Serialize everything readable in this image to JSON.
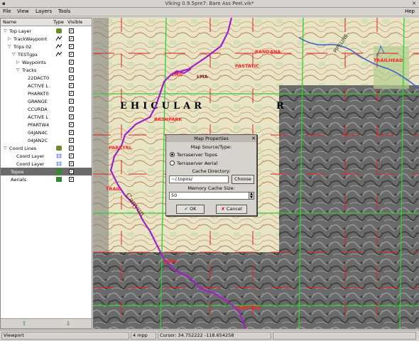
{
  "window": {
    "title": "Viking 0.9.5pre7: Bare Ass Peel.vik*",
    "close_glyph": "✕",
    "help_label": "Hep"
  },
  "menu": {
    "items": [
      "File",
      "View",
      "Layers",
      "Tools"
    ]
  },
  "layers_panel": {
    "headers": {
      "name": "Name",
      "type": "Type",
      "visible": "Visible"
    },
    "rows": [
      {
        "label": "Top Layer",
        "exp": "▽",
        "type": "aggregate-icon",
        "checked": true
      },
      {
        "label": "TrackWaypoint",
        "exp": "▷",
        "type": "trw-icon",
        "checked": true
      },
      {
        "label": "Trips 02",
        "exp": "▽",
        "type": "trw-icon",
        "checked": true
      },
      {
        "label": "TESTgps",
        "exp": "▽",
        "type": "trw-icon",
        "checked": true
      },
      {
        "label": "Waypoints",
        "exp": "▷",
        "type": "",
        "checked": true
      },
      {
        "label": "Tracks",
        "exp": "▽",
        "type": "",
        "checked": true
      },
      {
        "label": "22DACT0",
        "exp": "",
        "type": "",
        "checked": true
      },
      {
        "label": "ACTIVE L",
        "exp": "",
        "type": "",
        "checked": true
      },
      {
        "label": "PHARKT0",
        "exp": "",
        "type": "",
        "checked": true
      },
      {
        "label": "GRANGE",
        "exp": "",
        "type": "",
        "checked": true
      },
      {
        "label": "CCURDA",
        "exp": "",
        "type": "",
        "checked": true
      },
      {
        "label": "ACTIVE L",
        "exp": "",
        "type": "",
        "checked": true
      },
      {
        "label": "PFARTW4",
        "exp": "",
        "type": "",
        "checked": true
      },
      {
        "label": "04JAN4C",
        "exp": "",
        "type": "",
        "checked": true
      },
      {
        "label": "04JAN2C",
        "exp": "",
        "type": "",
        "checked": true
      },
      {
        "label": "Coord Lines",
        "exp": "▽",
        "type": "aggregate-icon",
        "checked": true
      },
      {
        "label": "Coord Layer",
        "exp": "",
        "type": "coord-icon",
        "checked": true
      },
      {
        "label": "Coord Layer",
        "exp": "",
        "type": "coord-icon",
        "checked": true
      },
      {
        "label": "Topos",
        "exp": "",
        "type": "map-icon",
        "checked": true,
        "selected": true
      },
      {
        "label": "Aerials",
        "exp": "",
        "type": "map-icon",
        "checked": true
      }
    ],
    "bottom": {
      "up_glyph": "⇧",
      "down_glyph": "⇩"
    }
  },
  "map": {
    "topo_labels": {
      "vehicular": "EHICULAR",
      "vehicular2": "R",
      "pipeline": "PIPELINE",
      "canyon": "Canyon"
    },
    "waypoints": [
      "1MG",
      "LMA",
      "PARKTRL",
      "BASHPARK",
      "PASTATIC",
      "BANDANA",
      "TRAIL",
      "TRAILHEAD",
      "MARTINA",
      "1993"
    ]
  },
  "dialog": {
    "title": "Map Properties",
    "close_glyph": "✕",
    "source_label": "Map Source/Type:",
    "options": [
      {
        "label": "Terraserver Topos",
        "selected": true
      },
      {
        "label": "Terraserver Aerial",
        "selected": false
      }
    ],
    "cache_label": "Cache Directory:",
    "cache_value": "~/.topos/",
    "choose_label": "Choose",
    "memory_label": "Memory Cache Size:",
    "memory_value": "50",
    "ok_label": "OK",
    "cancel_label": "Cancel"
  },
  "statusbar": {
    "tool": "Viewport",
    "zoom": "4 mpp",
    "cursor": "Cursor: 34.752222 -118.654258"
  }
}
